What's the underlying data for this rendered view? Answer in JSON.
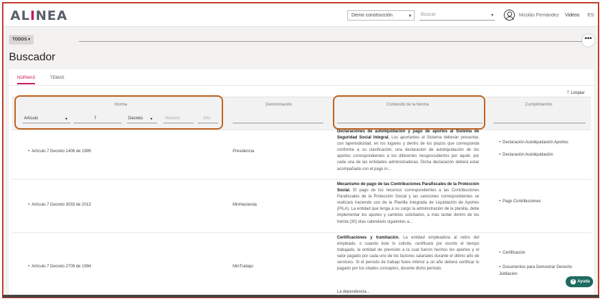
{
  "header": {
    "logo_pre": "AL",
    "logo_accent": "I",
    "logo_post": "NEA",
    "project": "Demo construcción",
    "search_placeholder": "Buscar",
    "user_name": "Nicolás Fernández",
    "videos": "Videos",
    "lang": "ES"
  },
  "toolbar": {
    "filter_label": "TODOS ▾",
    "more": "•••"
  },
  "page": {
    "title": "Buscador"
  },
  "tabs": [
    {
      "label": "NORMAS"
    },
    {
      "label": "TEMAS"
    }
  ],
  "clear_label": "Limpiar",
  "columns": {
    "norma": "Norma",
    "denominacion": "Denominación",
    "contenido": "Contenido de la Norma",
    "cumplimientos": "Cumplimientos"
  },
  "filters": {
    "articulo": "Artículo",
    "articulo_value": "7",
    "tipo": "Decreto",
    "numero_placeholder": "Número",
    "anio_placeholder": "Año"
  },
  "rows": [
    {
      "norma": "Artículo 7 Decreto 1406 de 1999",
      "denominacion": "Presidencia",
      "content_title": "Declaraciones de autoliquidación y pago de aportes al Sistema de Seguridad Social Integral.",
      "content_body": "Los aportantes al Sistema deberán presentar, con laperiodicidad, en los lugares y dentro de los plazos que corresponda conforme a su clasificación, una declaración de autoliquidación de los aportes correspondientes a los diferentes riesgoscubiertos por aquél, por cada una de las entidades administradoras. Dicha declaración deberá estar acompañada con el pago in...",
      "cumplimientos": [
        "Declaración Autoliquidación Aportes",
        "Declaración Autoliquidación"
      ]
    },
    {
      "norma": "Artículo 7 Decreto 3033 de 2013",
      "denominacion": "MinHacienda",
      "content_title": "Mecanismo de pago de las Contribuciones Parafiscales de la Protección Social.",
      "content_body": "El pago de los recursos correspondientes a las Contribuciones Parafiscales de la Protección Social y las sanciones correspondientes se realizará haciendo uso de la Planilla Integrada de Liquidación de Aportes (PILA). La entidad que tenga a su cargo la administración de la planilla, debe implementar los ajustes y cambios solicitados, a más tardar dentro de los treinta (30) días calendario siguientes a...",
      "cumplimientos": [
        "Pago Contribuciones"
      ]
    },
    {
      "norma": "Artículo 7 Decreto 2709 de 1994",
      "denominacion": "MinTrabajo",
      "content_title": "Certificaciones y tramitación.",
      "content_body": "La entidad empleadora al retiro del empleado, o cuando éste lo solicite, certificará por escrito el tiempo trabajado, la entidad de previsión a la cual fueron hechos los aportes y el valor pagado por cada uno de los factores salariales durante el último año de servicios. Si el período de trabajo fuere inferior a un año deberá certificar lo pagado por los citados conceptos, durante dicho período.",
      "content_extra": "La dependencia...",
      "cumplimientos": [
        "Certificación",
        "Documentos para Demostrar Derecho Jubilación"
      ]
    }
  ],
  "help": {
    "icon": "?",
    "label": "Ayuda"
  }
}
